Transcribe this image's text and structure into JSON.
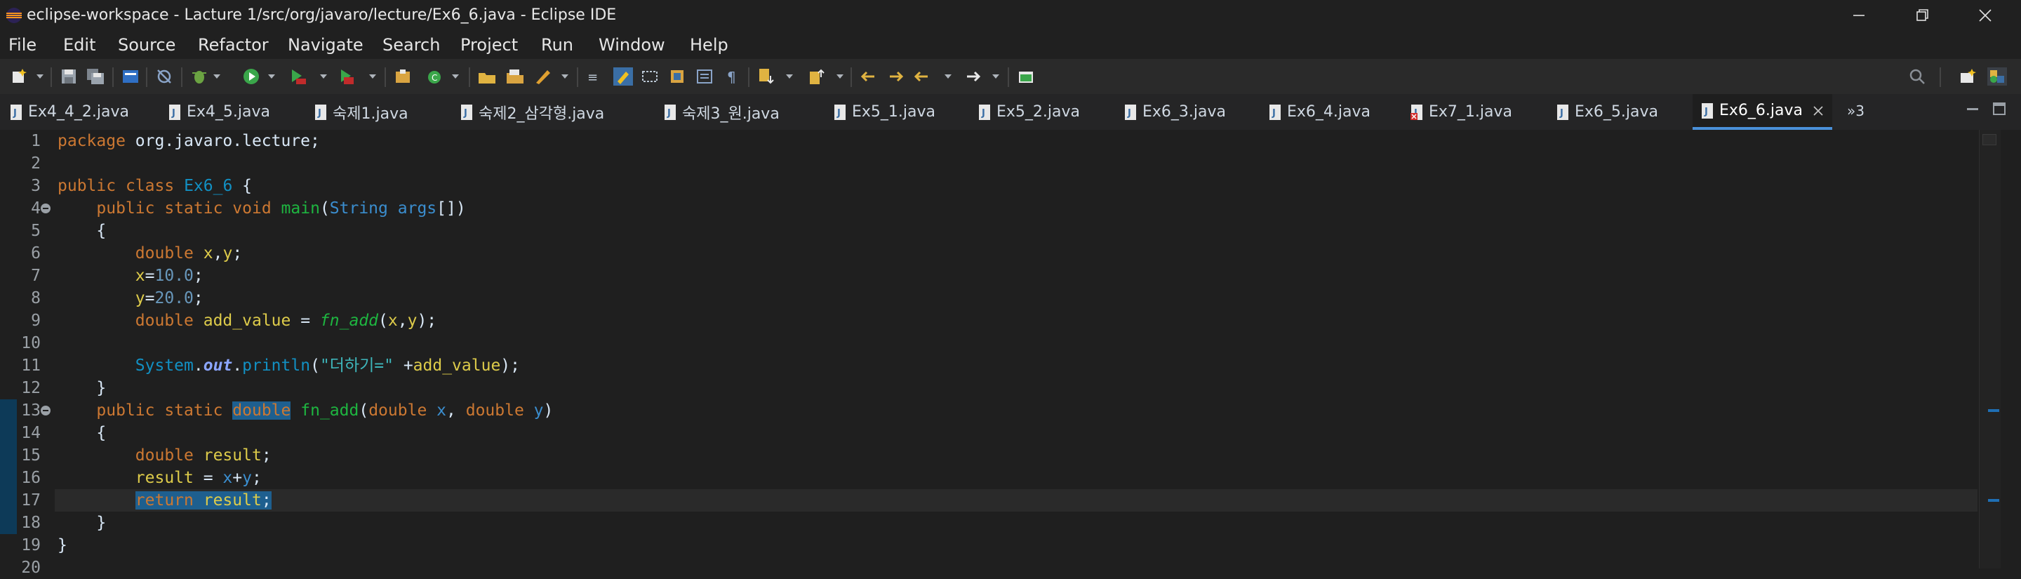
{
  "window": {
    "title": "eclipse-workspace - Lacture 1/src/org/javaro/lecture/Ex6_6.java - Eclipse IDE",
    "controls": [
      "minimize-icon",
      "restore-icon",
      "close-icon"
    ]
  },
  "menu": [
    "File",
    "Edit",
    "Source",
    "Refactor",
    "Navigate",
    "Search",
    "Project",
    "Run",
    "Window",
    "Help"
  ],
  "tabs": [
    {
      "label": "Ex4_4_2.java",
      "error": false
    },
    {
      "label": "Ex4_5.java",
      "error": false
    },
    {
      "label": "숙제1.java",
      "error": false
    },
    {
      "label": "숙제2_삼각형.java",
      "error": false
    },
    {
      "label": "숙제3_원.java",
      "error": false
    },
    {
      "label": "Ex5_1.java",
      "error": false
    },
    {
      "label": "Ex5_2.java",
      "error": false
    },
    {
      "label": "Ex6_3.java",
      "error": false
    },
    {
      "label": "Ex6_4.java",
      "error": false
    },
    {
      "label": "Ex7_1.java",
      "error": true
    },
    {
      "label": "Ex6_5.java",
      "error": false
    },
    {
      "label": "Ex6_6.java",
      "error": false,
      "active": true
    }
  ],
  "overflow_count": "»3",
  "editor": {
    "current_line": 17,
    "line_numbers": [
      "1",
      "2",
      "3",
      "4",
      "5",
      "6",
      "7",
      "8",
      "9",
      "10",
      "11",
      "12",
      "13",
      "14",
      "15",
      "16",
      "17",
      "18",
      "19",
      "20"
    ],
    "tokens": {
      "l1a": "package",
      "l1b": " org.javaro.lecture;",
      "l3a": "public",
      "l3b": " ",
      "l3c": "class",
      "l3d": " ",
      "l3e": "Ex6_6",
      "l3f": " {",
      "l4a": "    ",
      "l4b": "public",
      "l4c": " ",
      "l4d": "static",
      "l4e": " ",
      "l4f": "void",
      "l4g": " ",
      "l4h": "main",
      "l4i": "(",
      "l4j": "String",
      "l4k": " ",
      "l4l": "args",
      "l4m": "[])",
      "l5": "    {",
      "l6a": "        ",
      "l6b": "double",
      "l6c": " ",
      "l6d": "x",
      "l6e": ",",
      "l6f": "y",
      "l6g": ";",
      "l7a": "        ",
      "l7b": "x",
      "l7c": "=",
      "l7d": "10.0",
      "l7e": ";",
      "l8a": "        ",
      "l8b": "y",
      "l8c": "=",
      "l8d": "20.0",
      "l8e": ";",
      "l9a": "        ",
      "l9b": "double",
      "l9c": " ",
      "l9d": "add_value",
      "l9e": " = ",
      "l9f": "fn_add",
      "l9g": "(",
      "l9h": "x",
      "l9i": ",",
      "l9j": "y",
      "l9k": ");",
      "l11a": "        ",
      "l11b": "System",
      "l11c": ".",
      "l11d": "out",
      "l11e": ".",
      "l11f": "println",
      "l11g": "(",
      "l11h": "\"더하기=\"",
      "l11i": " +",
      "l11j": "add_value",
      "l11k": ");",
      "l12": "    }",
      "l13a": "    ",
      "l13b": "public",
      "l13c": " ",
      "l13d": "static",
      "l13e": " ",
      "l13f": "double",
      "l13g": " ",
      "l13h": "fn_add",
      "l13i": "(",
      "l13j": "double",
      "l13k": " ",
      "l13l": "x",
      "l13m": ", ",
      "l13n": "double",
      "l13o": " ",
      "l13p": "y",
      "l13q": ")",
      "l14": "    {",
      "l15a": "        ",
      "l15b": "double",
      "l15c": " ",
      "l15d": "result",
      "l15e": ";",
      "l16a": "        ",
      "l16b": "result",
      "l16c": " = ",
      "l16d": "x",
      "l16e": "+",
      "l16f": "y",
      "l16g": ";",
      "l17a": "        ",
      "l17b": "return",
      "l17c": " ",
      "l17d": "result",
      "l17e": ";",
      "l18": "    }",
      "l19": "}"
    }
  },
  "colors": {
    "keyword": "#cc7832",
    "class_name": "#1290c3",
    "variable": "#ddcb4a",
    "number": "#6897bb",
    "method": "#1eb540",
    "string": "#3eb5ba",
    "selection": "#1e5f8f",
    "active_tab_underline": "#4a90d9"
  }
}
